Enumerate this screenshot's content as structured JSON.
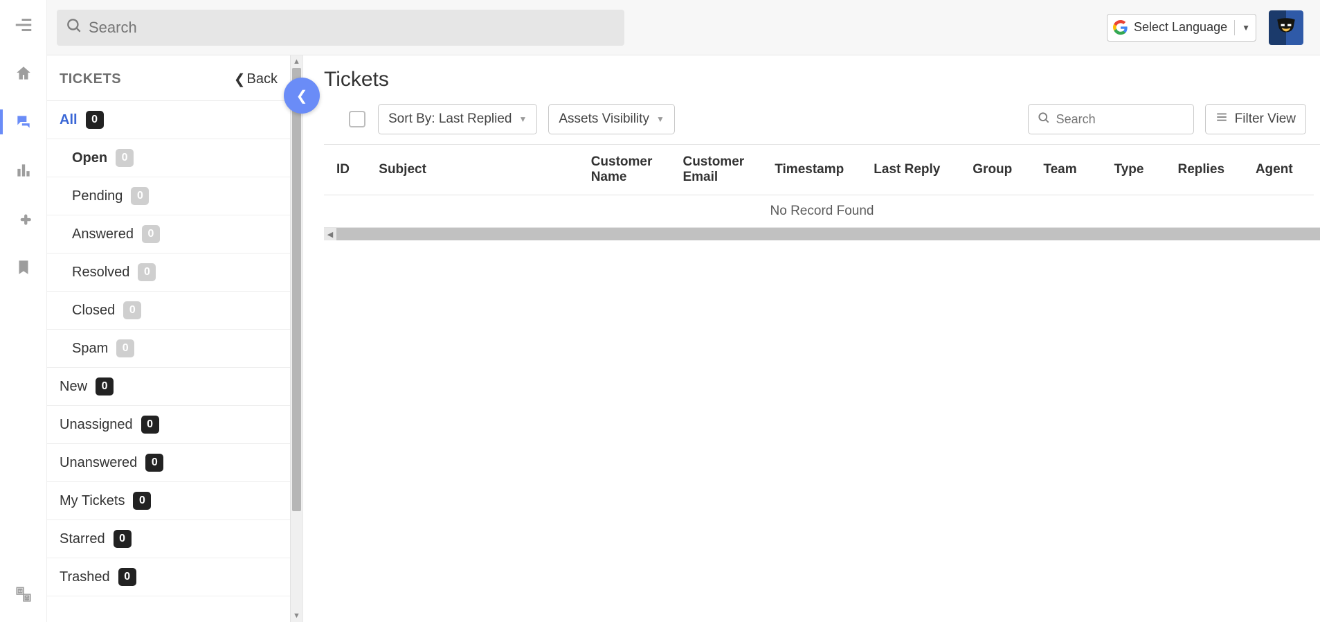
{
  "top": {
    "search_placeholder": "Search",
    "language_label": "Select Language"
  },
  "sidebar": {
    "title": "TICKETS",
    "back_label": "Back",
    "groups": [
      {
        "id": "all",
        "label": "All",
        "count": 0,
        "active": true,
        "badge": "dark",
        "sub": false,
        "bold": false
      },
      {
        "id": "open",
        "label": "Open",
        "count": 0,
        "active": false,
        "badge": "grey",
        "sub": true,
        "bold": true
      },
      {
        "id": "pending",
        "label": "Pending",
        "count": 0,
        "active": false,
        "badge": "grey",
        "sub": true,
        "bold": false
      },
      {
        "id": "answered",
        "label": "Answered",
        "count": 0,
        "active": false,
        "badge": "grey",
        "sub": true,
        "bold": false
      },
      {
        "id": "resolved",
        "label": "Resolved",
        "count": 0,
        "active": false,
        "badge": "grey",
        "sub": true,
        "bold": false
      },
      {
        "id": "closed",
        "label": "Closed",
        "count": 0,
        "active": false,
        "badge": "grey",
        "sub": true,
        "bold": false
      },
      {
        "id": "spam",
        "label": "Spam",
        "count": 0,
        "active": false,
        "badge": "grey",
        "sub": true,
        "bold": false
      },
      {
        "id": "new",
        "label": "New",
        "count": 0,
        "active": false,
        "badge": "dark",
        "sub": false,
        "bold": false
      },
      {
        "id": "unassigned",
        "label": "Unassigned",
        "count": 0,
        "active": false,
        "badge": "dark",
        "sub": false,
        "bold": false
      },
      {
        "id": "unanswered",
        "label": "Unanswered",
        "count": 0,
        "active": false,
        "badge": "dark",
        "sub": false,
        "bold": false
      },
      {
        "id": "mytickets",
        "label": "My Tickets",
        "count": 0,
        "active": false,
        "badge": "dark",
        "sub": false,
        "bold": false
      },
      {
        "id": "starred",
        "label": "Starred",
        "count": 0,
        "active": false,
        "badge": "dark",
        "sub": false,
        "bold": false
      },
      {
        "id": "trashed",
        "label": "Trashed",
        "count": 0,
        "active": false,
        "badge": "dark",
        "sub": false,
        "bold": false
      }
    ]
  },
  "main": {
    "title": "Tickets",
    "sort_label": "Sort By: Last Replied",
    "assets_label": "Assets Visibility",
    "search_placeholder": "Search",
    "filter_label": "Filter View",
    "columns": [
      "ID",
      "Subject",
      "Customer Name",
      "Customer Email",
      "Timestamp",
      "Last Reply",
      "Group",
      "Team",
      "Type",
      "Replies",
      "Agent"
    ],
    "empty_text": "No Record Found"
  }
}
